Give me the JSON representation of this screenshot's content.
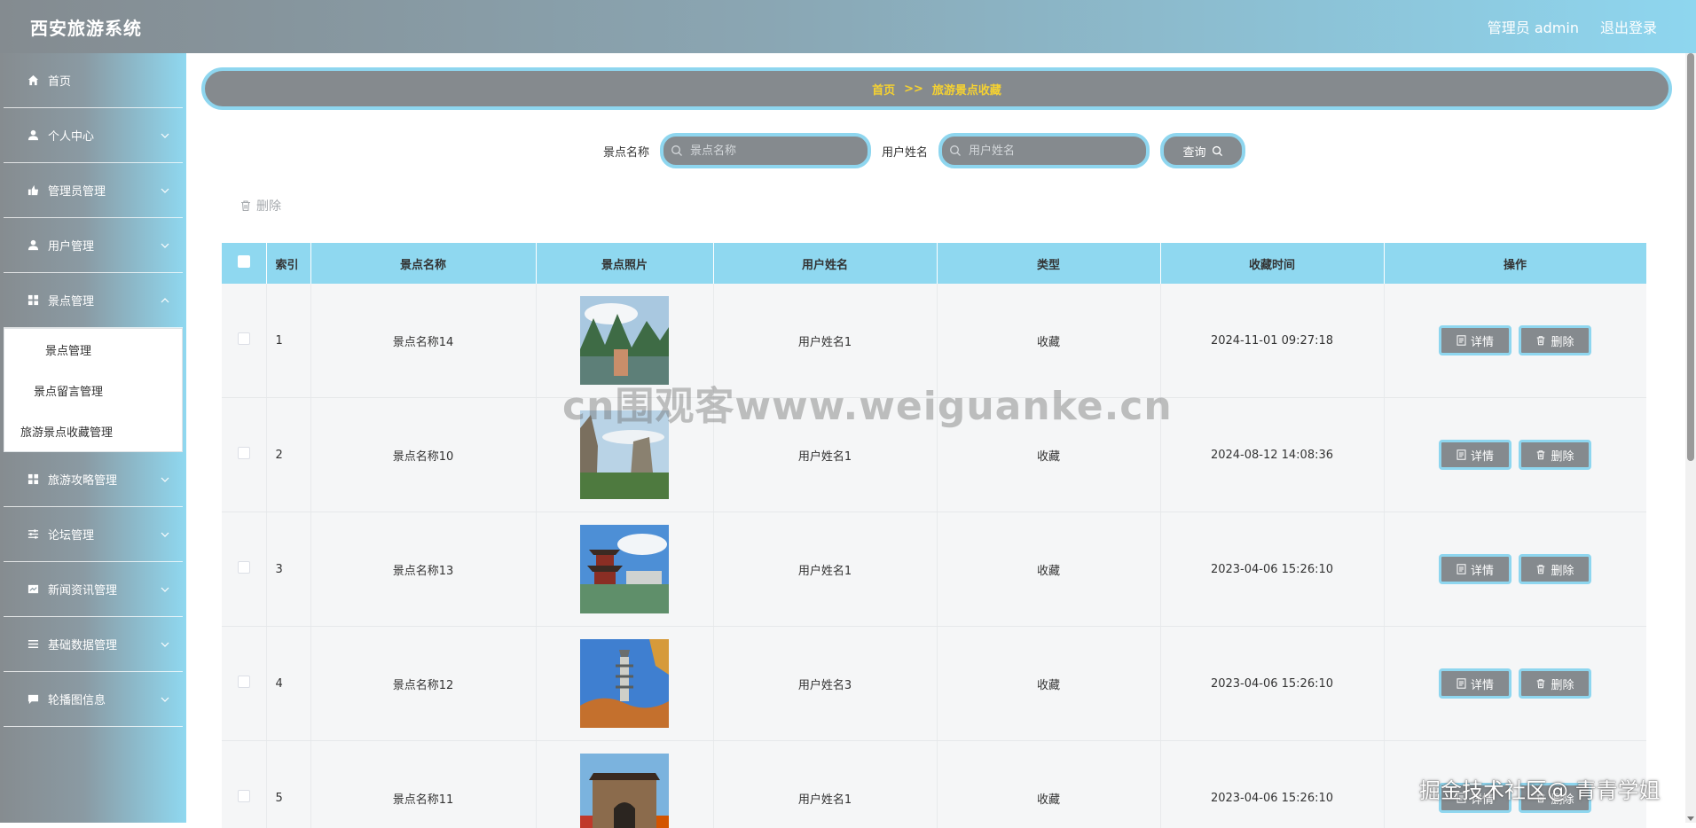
{
  "header": {
    "app_title": "西安旅游系统",
    "user_label": "管理员 admin",
    "logout_label": "退出登录"
  },
  "sidebar": {
    "items": [
      {
        "label": "首页",
        "icon": "home-icon"
      },
      {
        "label": "个人中心",
        "icon": "user-icon"
      },
      {
        "label": "管理员管理",
        "icon": "admin-icon"
      },
      {
        "label": "用户管理",
        "icon": "user-icon"
      },
      {
        "label": "景点管理",
        "icon": "grid-icon"
      },
      {
        "label": "旅游攻略管理",
        "icon": "grid-icon"
      },
      {
        "label": "论坛管理",
        "icon": "sliders-icon"
      },
      {
        "label": "新闻资讯管理",
        "icon": "news-icon"
      },
      {
        "label": "基础数据管理",
        "icon": "list-icon"
      },
      {
        "label": "轮播图信息",
        "icon": "chat-icon"
      }
    ],
    "submenu": [
      {
        "label": "景点管理"
      },
      {
        "label": "景点留言管理"
      },
      {
        "label": "旅游景点收藏管理"
      }
    ]
  },
  "breadcrumb": {
    "home": "首页",
    "separator": ">>",
    "current": "旅游景点收藏"
  },
  "search": {
    "spot_label": "景点名称",
    "spot_placeholder": "景点名称",
    "user_label": "用户姓名",
    "user_placeholder": "用户姓名",
    "query_label": "查询"
  },
  "toolbar": {
    "delete_label": "删除"
  },
  "table": {
    "columns": [
      "索引",
      "景点名称",
      "景点照片",
      "用户姓名",
      "类型",
      "收藏时间",
      "操作"
    ],
    "rows": [
      {
        "index": "1",
        "spot": "景点名称14",
        "user": "用户姓名1",
        "type": "收藏",
        "time": "2024-11-01 09:27:18",
        "photo": "karst-river"
      },
      {
        "index": "2",
        "spot": "景点名称10",
        "user": "用户姓名1",
        "type": "收藏",
        "time": "2024-08-12 14:08:36",
        "photo": "mountain-cliff"
      },
      {
        "index": "3",
        "spot": "景点名称13",
        "user": "用户姓名1",
        "type": "收藏",
        "time": "2023-04-06 15:26:10",
        "photo": "pavilion-lake"
      },
      {
        "index": "4",
        "spot": "景点名称12",
        "user": "用户姓名3",
        "type": "收藏",
        "time": "2023-04-06 15:26:10",
        "photo": "pagoda-autumn"
      },
      {
        "index": "5",
        "spot": "景点名称11",
        "user": "用户姓名1",
        "type": "收藏",
        "time": "2023-04-06 15:26:10",
        "photo": "city-gate"
      }
    ],
    "detail_label": "详情",
    "delete_label": "删除"
  },
  "watermarks": {
    "center": "cn围观客www.weiguanke.cn",
    "corner": "掘金技术社区@ 青青学姐"
  },
  "colors": {
    "accent": "#8ed6ef",
    "header_gray": "#848b90",
    "button_gray": "#858a8e",
    "breadcrumb_text": "#f6d230"
  }
}
